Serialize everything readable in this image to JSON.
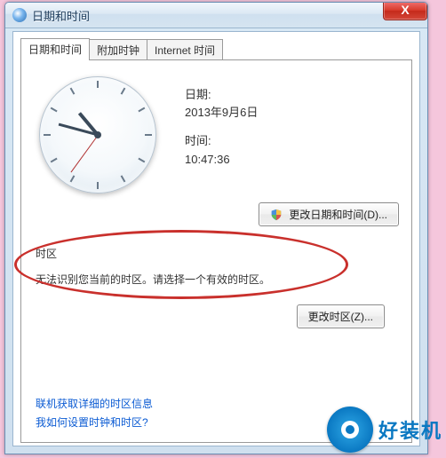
{
  "window": {
    "title": "日期和时间"
  },
  "tabs": [
    {
      "label": "日期和时间"
    },
    {
      "label": "附加时钟"
    },
    {
      "label": "Internet 时间"
    }
  ],
  "date_section": {
    "date_label": "日期:",
    "date_value": "2013年9月6日",
    "time_label": "时间:",
    "time_value": "10:47:36"
  },
  "buttons": {
    "change_datetime": "更改日期和时间(D)...",
    "change_timezone": "更改时区(Z)..."
  },
  "timezone_section": {
    "heading": "时区",
    "warning": "无法识别您当前的时区。请选择一个有效的时区。"
  },
  "links": {
    "detail_tz": "联机获取详细的时区信息",
    "how_set": "我如何设置时钟和时区?"
  },
  "watermark": {
    "text": "好装机"
  },
  "icons": {
    "close": "X",
    "shield": "shield-icon"
  }
}
